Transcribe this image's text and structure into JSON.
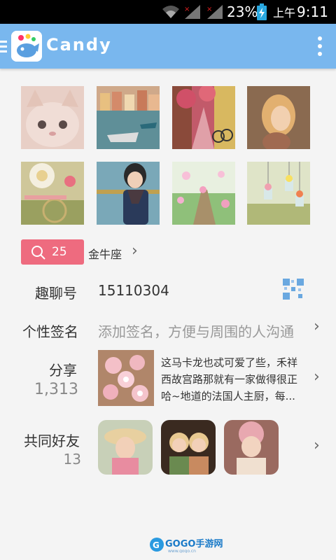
{
  "status_bar": {
    "battery": "23%",
    "time_period": "上午",
    "time": "9:11"
  },
  "app": {
    "title": "Candy"
  },
  "photos": [
    {
      "icon": "kitten-photo"
    },
    {
      "icon": "harbor-photo"
    },
    {
      "icon": "street-photo"
    },
    {
      "icon": "girl-photo"
    },
    {
      "icon": "bike-flowers-photo"
    },
    {
      "icon": "child-scarf-photo"
    },
    {
      "icon": "flower-path-photo"
    },
    {
      "icon": "hanging-jars-photo"
    }
  ],
  "profile": {
    "tag_count": "25",
    "zodiac": "金牛座",
    "id_label": "趣聊号",
    "id_value": "15110304",
    "signature_label": "个性签名",
    "signature_placeholder": "添加签名，方便与周围的人沟通",
    "share_label": "分享",
    "share_count": "1,313",
    "share_text": "这马卡龙也忒可爱了些，禾祥西故宫路那就有一家做得很正哈~地道的法国人主厨，每...",
    "friends_label": "共同好友",
    "friends_count": "13"
  },
  "footer": {
    "brand": "GOGO手游网",
    "url": "www.gogo.cn"
  },
  "colors": {
    "appbar": "#79b7ee",
    "tag": "#ee6b7f",
    "background": "#f4f4f4"
  }
}
